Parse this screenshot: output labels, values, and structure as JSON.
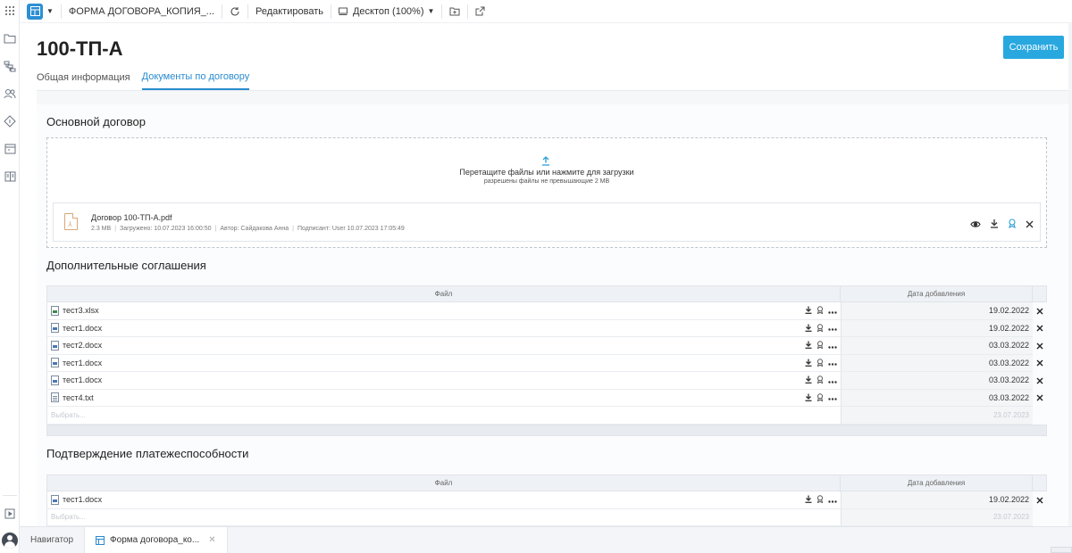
{
  "toolbar": {
    "doc_title": "ФОРМА ДОГОВОРА_КОПИЯ_...",
    "edit_label": "Редактировать",
    "view_mode": "Десктоп (100%)"
  },
  "page": {
    "title": "100-ТП-А",
    "save_label": "Сохранить",
    "tabs": [
      {
        "label": "Общая информация",
        "active": false
      },
      {
        "label": "Документы по договору",
        "active": true
      }
    ]
  },
  "main_contract": {
    "title": "Основной договор",
    "dropzone": {
      "main_text": "Перетащите файлы или нажмите для загрузки",
      "sub_text": "разрешены файлы не превышающие 2 MB"
    },
    "file": {
      "name": "Договор 100-ТП-А.pdf",
      "size": "2.3 MB",
      "uploaded": "Загружено: 10.07.2023 16:00:50",
      "author": "Автор: Сайдакова Анна",
      "signed": "Подписант: User 10.07.2023 17:05:49"
    }
  },
  "additional": {
    "title": "Дополнительные соглашения",
    "col_file": "Файл",
    "col_date": "Дата добавления",
    "rows": [
      {
        "name": "тест3.xlsx",
        "type": "xls",
        "date": "19.02.2022"
      },
      {
        "name": "тест1.docx",
        "type": "doc",
        "date": "19.02.2022"
      },
      {
        "name": "тест2.docx",
        "type": "doc",
        "date": "03.03.2022"
      },
      {
        "name": "тест1.docx",
        "type": "doc",
        "date": "03.03.2022"
      },
      {
        "name": "тест1.docx",
        "type": "doc",
        "date": "03.03.2022"
      },
      {
        "name": "тест4.txt",
        "type": "txt",
        "date": "03.03.2022"
      }
    ],
    "new_row": {
      "placeholder": "Выбрать...",
      "date": "23.07.2023"
    }
  },
  "solvency": {
    "title": "Подтверждение платежеспособности",
    "col_file": "Файл",
    "col_date": "Дата добавления",
    "rows": [
      {
        "name": "тест1.docx",
        "type": "doc",
        "date": "19.02.2022"
      }
    ],
    "new_row": {
      "placeholder": "Выбрать...",
      "date": "23.07.2023"
    }
  },
  "bottombar": {
    "navigator": "Навигатор",
    "open_tab": "Форма договора_ко..."
  },
  "colors": {
    "accent": "#2a8bd0",
    "save_button": "#29a8e0"
  }
}
